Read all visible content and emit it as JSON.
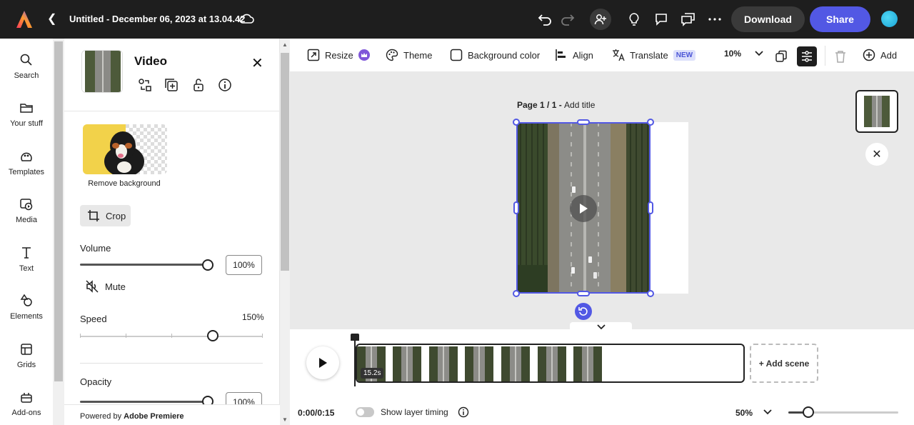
{
  "topbar": {
    "doc_title": "Untitled - December 06, 2023 at 13.04.42",
    "download_label": "Download",
    "share_label": "Share"
  },
  "rail": {
    "items": [
      {
        "label": "Search",
        "icon": "search-icon"
      },
      {
        "label": "Your stuff",
        "icon": "folder-icon"
      },
      {
        "label": "Templates",
        "icon": "templates-icon"
      },
      {
        "label": "Media",
        "icon": "media-icon"
      },
      {
        "label": "Text",
        "icon": "text-icon"
      },
      {
        "label": "Elements",
        "icon": "elements-icon"
      },
      {
        "label": "Grids",
        "icon": "grids-icon"
      },
      {
        "label": "Add-ons",
        "icon": "addons-icon"
      }
    ]
  },
  "panel": {
    "title": "Video",
    "remove_bg_label": "Remove background",
    "crop_label": "Crop",
    "volume_label": "Volume",
    "volume_value": "100%",
    "volume_fraction": 1.0,
    "mute_label": "Mute",
    "speed_label": "Speed",
    "speed_value": "150%",
    "opacity_label": "Opacity",
    "opacity_value": "100%",
    "powered_prefix": "Powered by ",
    "powered_brand": "Adobe Premiere"
  },
  "canvas_toolbar": {
    "resize_label": "Resize",
    "theme_label": "Theme",
    "bgcolor_label": "Background color",
    "align_label": "Align",
    "translate_label": "Translate",
    "new_badge": "NEW",
    "zoom_value": "10%",
    "add_label": "Add"
  },
  "canvas": {
    "page_prefix": "Page 1 / 1 - ",
    "page_title_placeholder": "Add title"
  },
  "timeline": {
    "clip_duration": "15.2s",
    "add_scene_label": "+ Add scene",
    "time": "0:00/0:15",
    "show_layer_timing_label": "Show layer timing",
    "zoom_value": "50%"
  },
  "colors": {
    "accent": "#5258e4",
    "topbar": "#1e1e1e"
  }
}
